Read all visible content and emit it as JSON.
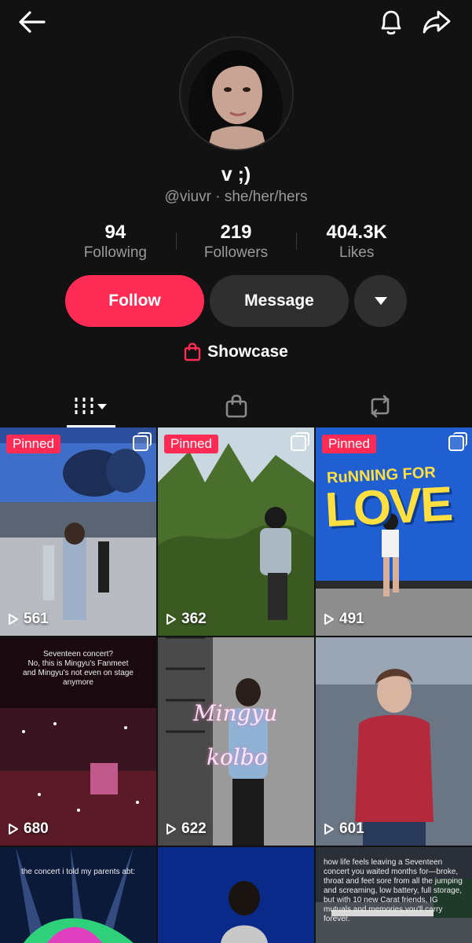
{
  "profile": {
    "display_name": "v ;)",
    "handle_line": "@viuvr · she/her/hers"
  },
  "stats": [
    {
      "value": "94",
      "label": "Following"
    },
    {
      "value": "219",
      "label": "Followers"
    },
    {
      "value": "404.3K",
      "label": "Likes"
    }
  ],
  "actions": {
    "follow_label": "Follow",
    "message_label": "Message"
  },
  "showcase": {
    "label": "Showcase"
  },
  "tabs": [
    {
      "icon": "grid-icon",
      "active": true
    },
    {
      "icon": "shopping-bag-icon",
      "active": false
    },
    {
      "icon": "repost-icon",
      "active": false
    }
  ],
  "videos": [
    {
      "pinned_label": "Pinned",
      "views": "561",
      "multi": true
    },
    {
      "pinned_label": "Pinned",
      "views": "362",
      "multi": true
    },
    {
      "pinned_label": "Pinned",
      "views": "491",
      "multi": true,
      "poster_top": "RuNNING FOR",
      "poster_big": "LOVE"
    },
    {
      "views": "680",
      "caption": "Seventeen concert?\nNo, this is Mingyu's Fanmeet\nand Mingyu's not even on stage anymore"
    },
    {
      "views": "622",
      "overlay_1": "Mingyu",
      "overlay_2": "kolbo"
    },
    {
      "views": "601"
    },
    {
      "caption": "the concert i told my parents abt:"
    },
    {},
    {
      "caption": "how life feels leaving a Seventeen concert you waited months for—broke, throat and feet sore from all the jumping and screaming, low battery, full storage, but with 10 new Carat friends, IG mutuals and memories you'll carry forever."
    }
  ],
  "colors": {
    "accent": "#fe2c55",
    "background": "#121212",
    "button_dark": "#2f2f2f"
  }
}
